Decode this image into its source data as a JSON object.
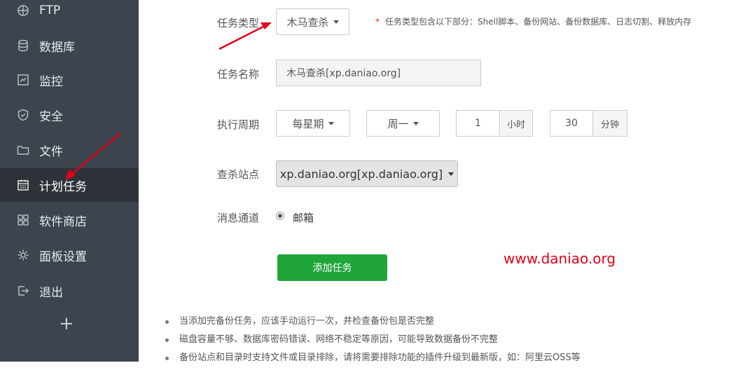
{
  "sidebar": {
    "items": [
      {
        "label": "FTP",
        "icon": "ftp-icon"
      },
      {
        "label": "数据库",
        "icon": "database-icon"
      },
      {
        "label": "监控",
        "icon": "monitor-icon"
      },
      {
        "label": "安全",
        "icon": "shield-icon"
      },
      {
        "label": "文件",
        "icon": "folder-icon"
      },
      {
        "label": "计划任务",
        "icon": "calendar-icon",
        "active": true
      },
      {
        "label": "软件商店",
        "icon": "grid-icon"
      },
      {
        "label": "面板设置",
        "icon": "gear-icon"
      },
      {
        "label": "退出",
        "icon": "logout-icon"
      }
    ],
    "add_label": "+"
  },
  "form": {
    "task_type_label": "任务类型",
    "task_type_value": "木马查杀",
    "task_type_hint_star": "*",
    "task_type_hint": "任务类型包含以下部分：Shell脚本、备份网站、备份数据库、日志切割、释放内存",
    "task_name_label": "任务名称",
    "task_name_value": "木马查杀[xp.daniao.org]",
    "period_label": "执行周期",
    "period_value": "每星期",
    "weekday_value": "周一",
    "hour_value": "1",
    "hour_unit": "小时",
    "minute_value": "30",
    "minute_unit": "分钟",
    "site_label": "查杀站点",
    "site_value": "xp.daniao.org[xp.daniao.org]",
    "channel_label": "消息通道",
    "channel_value": "邮箱",
    "submit_label": "添加任务"
  },
  "watermark": "www.daniao.org",
  "tips": [
    "当添加完备份任务，应该手动运行一次，并检查备份包是否完整",
    "磁盘容量不够、数据库密码错误、网络不稳定等原因，可能导致数据备份不完整",
    "备份站点和目录时支持文件或目录排除，请将需要排除功能的插件升级到最新版，如：阿里云OSS等"
  ],
  "colors": {
    "sidebar_bg": "#3c444d",
    "active_bg": "#2d3338",
    "primary": "#20a53a",
    "annotation": "#e3001b"
  }
}
